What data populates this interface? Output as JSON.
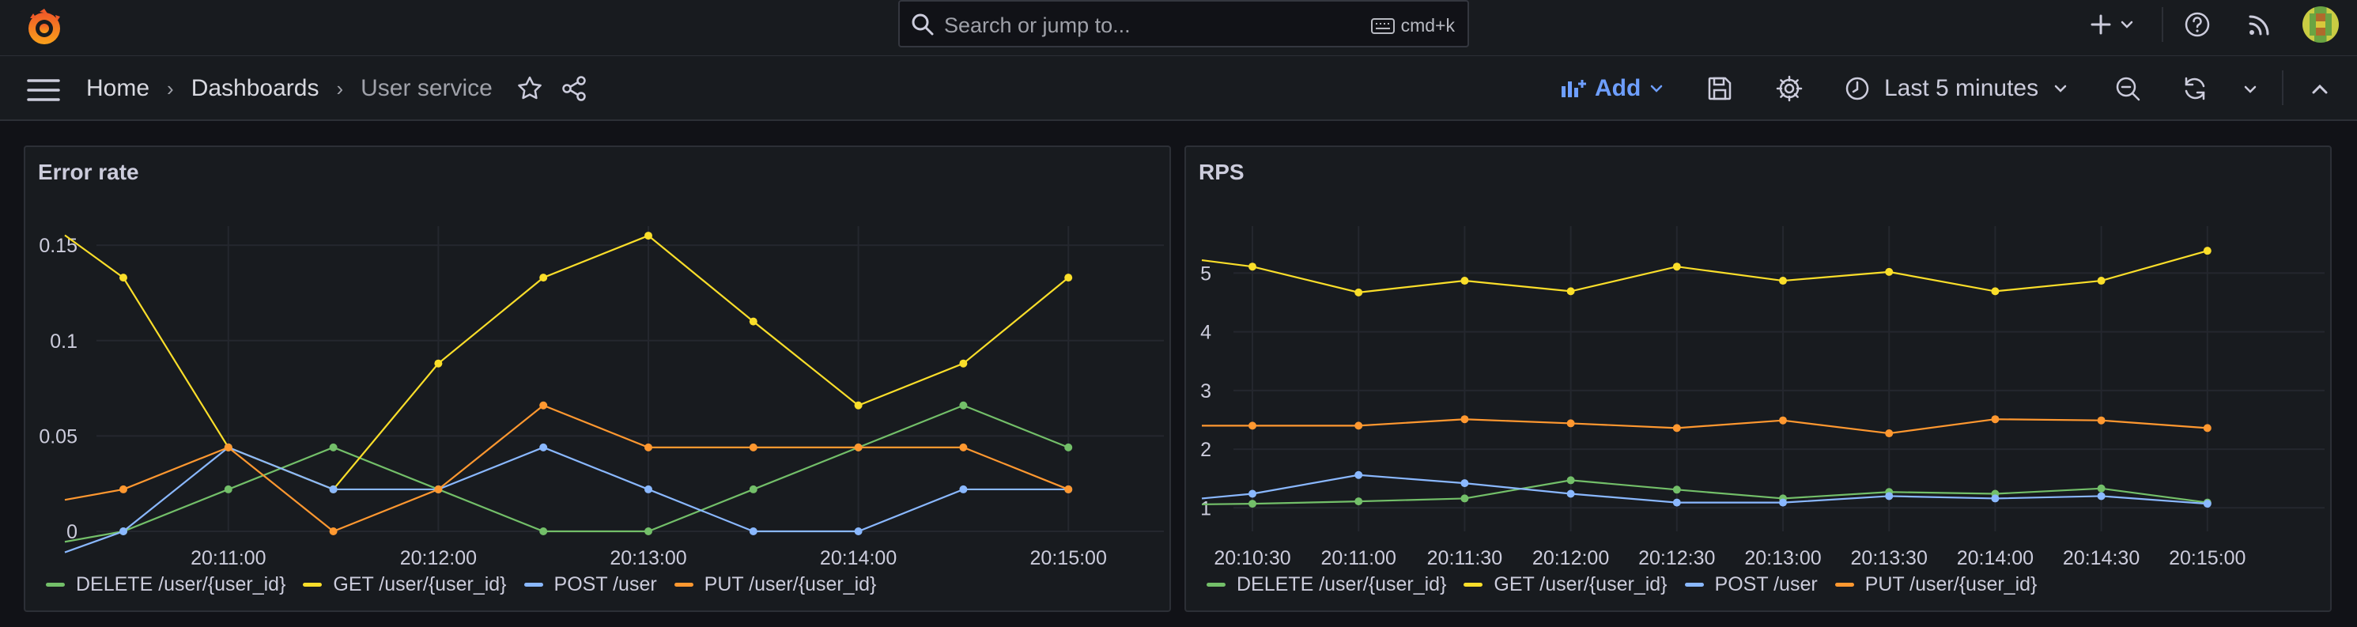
{
  "search": {
    "placeholder": "Search or jump to...",
    "shortcut": "cmd+k"
  },
  "breadcrumb": {
    "home": "Home",
    "dashboards": "Dashboards",
    "current": "User service"
  },
  "toolbar": {
    "add_label": "Add",
    "time_range": "Last 5 minutes"
  },
  "colors": {
    "accent": "#6e9fff",
    "green": "#73bf69",
    "yellow": "#fade2a",
    "blue": "#8ab8ff",
    "orange": "#ff9830"
  },
  "icons": [
    "grafana-logo-icon",
    "search-icon",
    "keyboard-icon",
    "plus-icon",
    "chevron-down-icon",
    "help-icon",
    "rss-icon",
    "avatar",
    "menu-icon",
    "star-icon",
    "share-icon",
    "add-panel-icon",
    "save-icon",
    "gear-icon",
    "clock-icon",
    "zoom-out-icon",
    "refresh-icon",
    "collapse-icon"
  ],
  "panels": {
    "error_rate": {
      "title": "Error rate",
      "legend": [
        "DELETE /user/{user_id}",
        "GET /user/{user_id}",
        "POST /user",
        "PUT /user/{user_id}"
      ]
    },
    "rps": {
      "title": "RPS",
      "legend": [
        "DELETE /user/{user_id}",
        "GET /user/{user_id}",
        "POST /user",
        "PUT /user/{user_id}"
      ]
    }
  },
  "chart_data": [
    {
      "type": "line",
      "title": "Error rate",
      "x": [
        "20:10:30",
        "20:11:00",
        "20:11:30",
        "20:12:00",
        "20:12:30",
        "20:13:00",
        "20:13:30",
        "20:14:00",
        "20:14:30",
        "20:15:00"
      ],
      "x_tick_labels": [
        "20:11:00",
        "20:12:00",
        "20:13:00",
        "20:14:00",
        "20:15:00"
      ],
      "y_ticks": [
        "0",
        "0.05",
        "0.1",
        "0.15"
      ],
      "ylim": [
        0,
        0.16
      ],
      "grid": true,
      "legend_position": "bottom-left",
      "series": [
        {
          "name": "DELETE /user/{user_id}",
          "color": "#73bf69",
          "values": [
            0,
            0.022,
            0.044,
            0.022,
            0,
            0,
            0.022,
            0.044,
            0.066,
            0.044
          ]
        },
        {
          "name": "GET /user/{user_id}",
          "color": "#fade2a",
          "values": [
            0.133,
            0.044,
            0.022,
            0.088,
            0.133,
            0.155,
            0.11,
            0.066,
            0.088,
            0.133
          ]
        },
        {
          "name": "POST /user",
          "color": "#8ab8ff",
          "values": [
            0,
            0.044,
            0.022,
            0.022,
            0.044,
            0.022,
            0,
            0,
            0.022,
            0.022
          ]
        },
        {
          "name": "PUT /user/{user_id}",
          "color": "#ff9830",
          "values": [
            0.022,
            0.044,
            0,
            0.022,
            0.066,
            0.044,
            0.044,
            0.044,
            0.044,
            0.022
          ]
        }
      ]
    },
    {
      "type": "line",
      "title": "RPS",
      "x": [
        "20:10:30",
        "20:11:00",
        "20:11:30",
        "20:12:00",
        "20:12:30",
        "20:13:00",
        "20:13:30",
        "20:14:00",
        "20:14:30",
        "20:15:00"
      ],
      "x_tick_labels": [
        "20:10:30",
        "20:11:00",
        "20:11:30",
        "20:12:00",
        "20:12:30",
        "20:13:00",
        "20:13:30",
        "20:14:00",
        "20:14:30",
        "20:15:00"
      ],
      "y_ticks": [
        "1",
        "2",
        "3",
        "4",
        "5"
      ],
      "ylim": [
        0.6,
        5.8
      ],
      "grid": true,
      "legend_position": "bottom-left",
      "series": [
        {
          "name": "DELETE /user/{user_id}",
          "color": "#73bf69",
          "values": [
            1.07,
            1.11,
            1.16,
            1.47,
            1.31,
            1.16,
            1.27,
            1.24,
            1.33,
            1.09
          ]
        },
        {
          "name": "GET /user/{user_id}",
          "color": "#fade2a",
          "values": [
            5.11,
            4.67,
            4.87,
            4.69,
            5.11,
            4.87,
            5.02,
            4.69,
            4.87,
            5.38
          ]
        },
        {
          "name": "POST /user",
          "color": "#8ab8ff",
          "values": [
            1.24,
            1.56,
            1.42,
            1.24,
            1.09,
            1.09,
            1.2,
            1.16,
            1.2,
            1.07
          ]
        },
        {
          "name": "PUT /user/{user_id}",
          "color": "#ff9830",
          "values": [
            2.4,
            2.4,
            2.51,
            2.44,
            2.36,
            2.49,
            2.27,
            2.51,
            2.49,
            2.36
          ]
        }
      ]
    }
  ]
}
